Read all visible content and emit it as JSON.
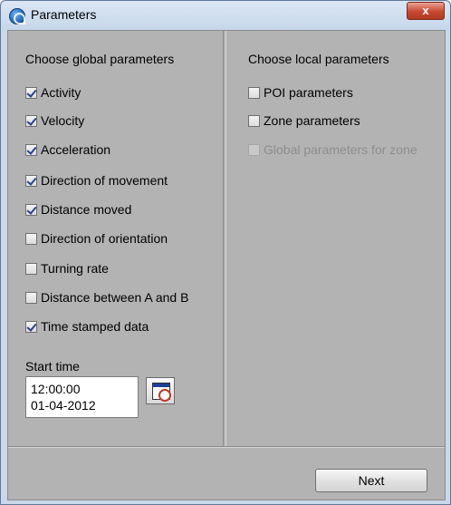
{
  "window": {
    "title": "Parameters",
    "close_label": "x"
  },
  "global": {
    "heading": "Choose global parameters",
    "items": [
      {
        "label": "Activity",
        "checked": true
      },
      {
        "label": "Velocity",
        "checked": true
      },
      {
        "label": "Acceleration",
        "checked": true
      },
      {
        "label": "Direction of movement",
        "checked": true
      },
      {
        "label": "Distance moved",
        "checked": true
      },
      {
        "label": "Direction of orientation",
        "checked": false
      },
      {
        "label": "Turning rate",
        "checked": false
      },
      {
        "label": "Distance between A and B",
        "checked": false
      },
      {
        "label": "Time stamped data",
        "checked": true
      }
    ]
  },
  "local": {
    "heading": "Choose local parameters",
    "items": [
      {
        "label": "POI parameters",
        "checked": false,
        "enabled": true
      },
      {
        "label": "Zone parameters",
        "checked": false,
        "enabled": true
      },
      {
        "label": "Global parameters for zone",
        "checked": false,
        "enabled": false
      }
    ]
  },
  "start_time": {
    "label": "Start time",
    "time": "12:00:00",
    "date": "01-04-2012",
    "calendar_icon": "calendar-icon"
  },
  "footer": {
    "next_label": "Next"
  }
}
